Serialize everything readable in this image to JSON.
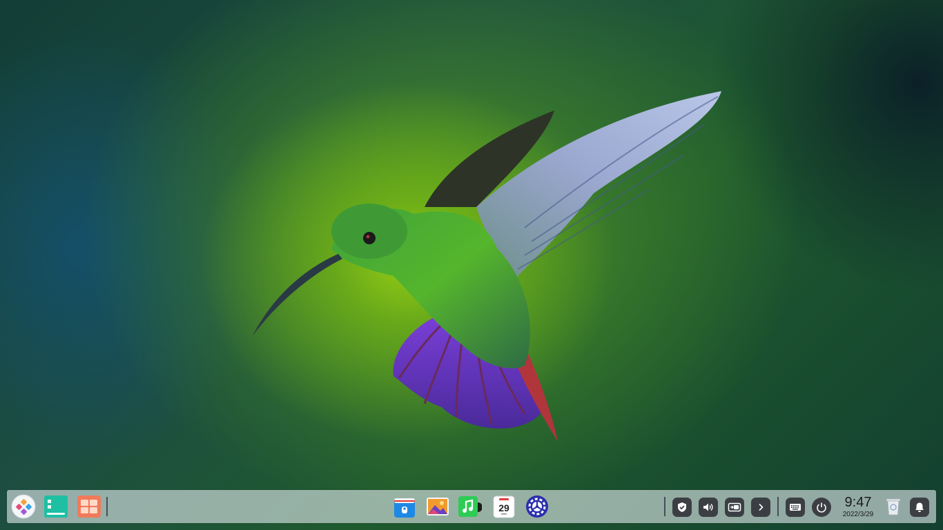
{
  "wallpaper": {
    "subject": "hummingbird-wallpaper"
  },
  "taskbar": {
    "left_apps": [
      {
        "name": "launcher-icon"
      },
      {
        "name": "multitask-view-icon"
      },
      {
        "name": "workspace-icon"
      }
    ],
    "dock_apps": [
      {
        "name": "app-store-icon"
      },
      {
        "name": "image-viewer-icon"
      },
      {
        "name": "music-icon"
      },
      {
        "name": "calendar-icon",
        "calendar_day": "29"
      },
      {
        "name": "control-center-icon"
      }
    ],
    "tray": [
      {
        "name": "security-shield-icon"
      },
      {
        "name": "volume-icon"
      },
      {
        "name": "display-mode-icon"
      },
      {
        "name": "chevron-right-icon"
      },
      {
        "name": "keyboard-icon"
      },
      {
        "name": "power-icon"
      }
    ],
    "clock": {
      "time": "9:47",
      "date": "2022/3/29"
    },
    "trash": {
      "name": "trash-icon"
    },
    "notifications": {
      "name": "bell-icon"
    }
  },
  "colors": {
    "taskbar_bg": "#e1e8ec",
    "tray_button_bg": "#3b3f44",
    "accent_teal": "#1fbfa3",
    "calendar_red": "#e23b3b"
  }
}
